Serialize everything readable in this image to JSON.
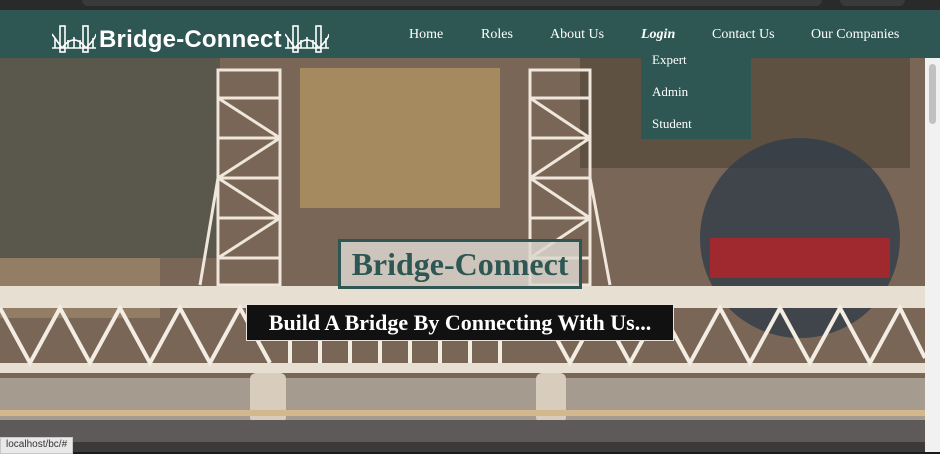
{
  "brand": {
    "name": "Bridge-Connect"
  },
  "nav": {
    "items": [
      {
        "label": "Home"
      },
      {
        "label": "Roles"
      },
      {
        "label": "About Us"
      },
      {
        "label": "Login"
      },
      {
        "label": "Contact Us"
      },
      {
        "label": "Our Companies"
      }
    ],
    "active": "Login"
  },
  "login_dropdown": {
    "items": [
      {
        "label": "Expert"
      },
      {
        "label": "Admin"
      },
      {
        "label": "Student"
      }
    ]
  },
  "hero": {
    "title": "Bridge-Connect",
    "subtitle": "Build A Bridge By Connecting With Us..."
  },
  "status": {
    "url": "localhost/bc/#"
  },
  "colors": {
    "primary": "#2e5753",
    "text_light": "#ffffff",
    "dark": "#111111"
  },
  "icons": {
    "logo": "bridge-icon"
  }
}
